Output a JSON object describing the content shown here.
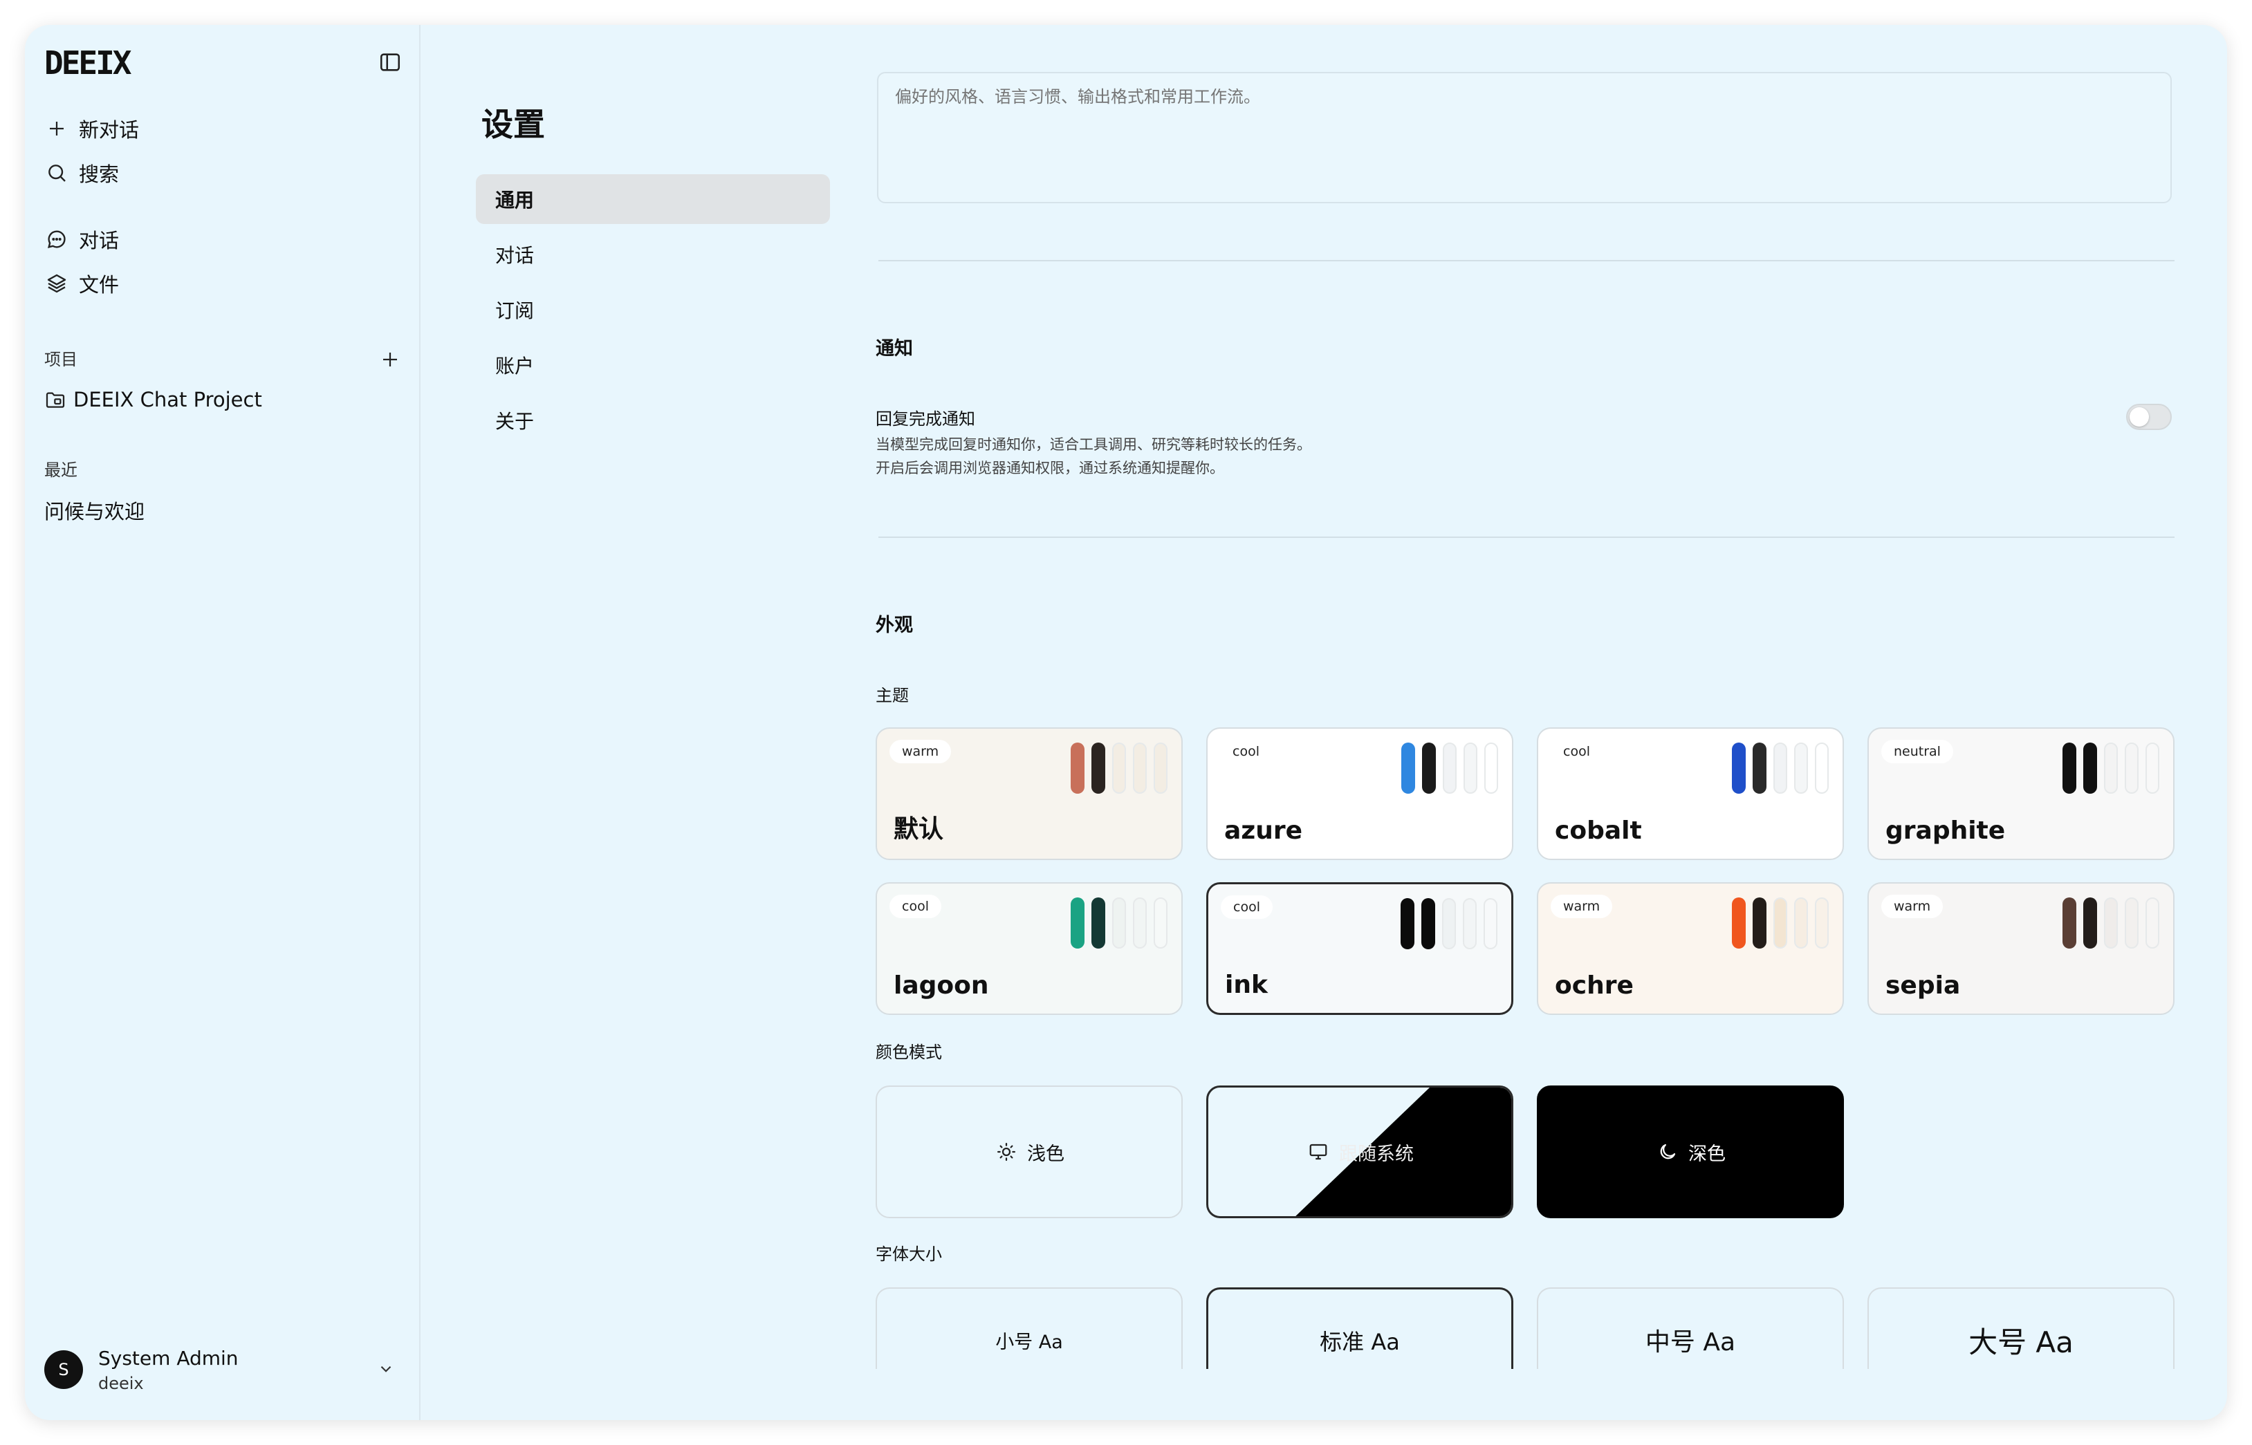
{
  "app": {
    "logo": "DEEIX"
  },
  "sidebar": {
    "new_chat": "新对话",
    "search": "搜索",
    "chats": "对话",
    "files": "文件",
    "projects_label": "项目",
    "project_name": "DEEIX Chat Project",
    "recent_label": "最近",
    "recent_item": "问候与欢迎",
    "user_name": "System Admin",
    "user_handle": "deeix",
    "avatar_letter": "S"
  },
  "settings": {
    "title": "设置",
    "nav": [
      "通用",
      "对话",
      "订阅",
      "账户",
      "关于"
    ],
    "active_nav": "通用"
  },
  "content": {
    "preferences_placeholder": "偏好的风格、语言习惯、输出格式和常用工作流。",
    "notifications": {
      "heading": "通知",
      "reply_label": "回复完成通知",
      "reply_desc_1": "当模型完成回复时通知你，适合工具调用、研究等耗时较长的任务。",
      "reply_desc_2": "开启后会调用浏览器通知权限，通过系统通知提醒你。",
      "enabled": false
    },
    "appearance": {
      "heading": "外观",
      "theme_label": "主题",
      "themes": [
        {
          "name": "默认",
          "tone": "warm",
          "bg": "#f7f4ee",
          "colors": [
            "#c8705a",
            "#2b2420",
            "#f3ede3",
            "#f3ede3",
            "#f3ede3"
          ]
        },
        {
          "name": "azure",
          "tone": "cool",
          "bg": "#ffffff",
          "colors": [
            "#2f87e0",
            "#1b1b1b",
            "#f1f3f5",
            "#f4f6f7",
            "#ffffff"
          ]
        },
        {
          "name": "cobalt",
          "tone": "cool",
          "bg": "#ffffff",
          "colors": [
            "#1f4fc9",
            "#2a2a2a",
            "#f1f3f5",
            "#f4f6f7",
            "#ffffff"
          ]
        },
        {
          "name": "graphite",
          "tone": "neutral",
          "bg": "#f8f8f8",
          "colors": [
            "#111111",
            "#111111",
            "#f3f3f3",
            "#f5f5f5",
            "#f8f8f8"
          ]
        },
        {
          "name": "lagoon",
          "tone": "cool",
          "bg": "#f4f8f7",
          "colors": [
            "#1aa383",
            "#143934",
            "#eef3f1",
            "#f1f5f4",
            "#f6f9f8"
          ]
        },
        {
          "name": "ink",
          "tone": "cool",
          "bg": "#f6f9fa",
          "colors": [
            "#0b0b0b",
            "#0b0b0b",
            "#eef2f3",
            "#f2f5f6",
            "#f7f9fa"
          ]
        },
        {
          "name": "ochre",
          "tone": "warm",
          "bg": "#fbf5ee",
          "colors": [
            "#f0561e",
            "#231d19",
            "#f3e5d2",
            "#f6ede2",
            "#f8f1e8"
          ]
        },
        {
          "name": "sepia",
          "tone": "warm",
          "bg": "#f6f5f4",
          "colors": [
            "#5a3e34",
            "#231d1a",
            "#efecea",
            "#f2f0ee",
            "#f6f5f4"
          ]
        }
      ],
      "selected_theme": "ink",
      "color_mode_label": "颜色模式",
      "color_modes": [
        "浅色",
        "跟随系统",
        "深色"
      ],
      "selected_mode": "跟随系统",
      "font_size_label": "字体大小",
      "font_sizes": [
        "小号 Aa",
        "标准 Aa",
        "中号 Aa",
        "大号 Aa"
      ],
      "selected_font": "标准 Aa"
    }
  }
}
